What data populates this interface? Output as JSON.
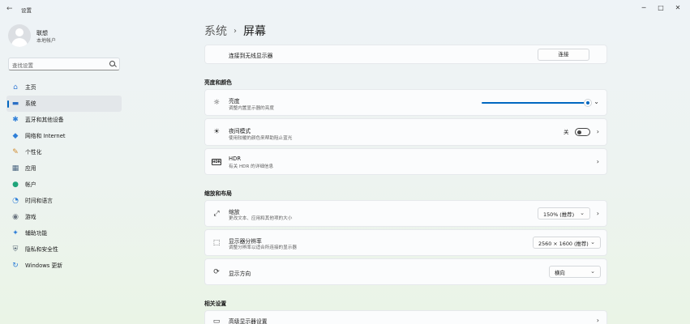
{
  "window": {
    "title": "设置",
    "back_glyph": "←",
    "minimize_glyph": "─",
    "maximize_glyph": "□",
    "close_glyph": "✕"
  },
  "profile": {
    "name": "联想",
    "account": "本地帐户"
  },
  "search": {
    "placeholder": "查找设置"
  },
  "nav": {
    "items": [
      {
        "label": "主页",
        "icon": "home-icon",
        "glyph": "⌂",
        "color": "#3b7ed6"
      },
      {
        "label": "系统",
        "icon": "monitor-icon",
        "glyph": "▬",
        "color": "#2b6fc5",
        "active": true
      },
      {
        "label": "蓝牙和其他设备",
        "icon": "bluetooth-icon",
        "glyph": "✱",
        "color": "#2f7fd8"
      },
      {
        "label": "网络和 Internet",
        "icon": "wifi-icon",
        "glyph": "◆",
        "color": "#2f7fd8"
      },
      {
        "label": "个性化",
        "icon": "brush-icon",
        "glyph": "✎",
        "color": "#d08a2e"
      },
      {
        "label": "应用",
        "icon": "apps-icon",
        "glyph": "▦",
        "color": "#4c6680"
      },
      {
        "label": "帐户",
        "icon": "person-icon",
        "glyph": "●",
        "color": "#1fa47a"
      },
      {
        "label": "时间和语言",
        "icon": "globe-clock-icon",
        "glyph": "◔",
        "color": "#2f7fd8"
      },
      {
        "label": "游戏",
        "icon": "gamepad-icon",
        "glyph": "◉",
        "color": "#6b7580"
      },
      {
        "label": "辅助功能",
        "icon": "accessibility-icon",
        "glyph": "✦",
        "color": "#2f7fd8"
      },
      {
        "label": "隐私和安全性",
        "icon": "shield-icon",
        "glyph": "⛨",
        "color": "#5a6a78"
      },
      {
        "label": "Windows 更新",
        "icon": "update-icon",
        "glyph": "↻",
        "color": "#2f7fd8"
      }
    ]
  },
  "breadcrumb": {
    "parent": "系统",
    "separator": "›",
    "current": "屏幕"
  },
  "wireless": {
    "label": "连接到无线显示器",
    "button": "连接"
  },
  "sections": {
    "brightness": "亮度和颜色",
    "scale_layout": "缩放和布局",
    "related": "相关设置"
  },
  "brightness": {
    "title": "亮度",
    "subtitle": "调整内置显示器的亮度",
    "icon_glyph": "☼",
    "level_percent": 100,
    "chevron": "⌄"
  },
  "night_light": {
    "title": "夜间模式",
    "subtitle": "使用较暖的颜色来帮助阻止蓝光",
    "icon_glyph": "☀",
    "state_label": "关",
    "chevron": "›"
  },
  "hdr": {
    "title": "HDR",
    "subtitle": "有关 HDR 的详细信息",
    "icon_text": "HDR",
    "chevron": "›"
  },
  "scale": {
    "title": "缩放",
    "subtitle": "更改文本、应用和其他项的大小",
    "icon_glyph": "⤢",
    "value": "150% (推荐)",
    "dropdown_glyph": "⌄",
    "chevron": "›"
  },
  "resolution": {
    "title": "显示器分辨率",
    "subtitle": "调整分辨率以适合所连接的显示器",
    "icon_glyph": "⬚",
    "value": "2560 × 1600 (推荐)",
    "dropdown_glyph": "⌄"
  },
  "orientation": {
    "title": "显示方向",
    "icon_glyph": "⟳",
    "value": "横向",
    "dropdown_glyph": "⌄"
  },
  "advanced": {
    "title": "高级显示器设置",
    "icon_glyph": "▭",
    "chevron": "›"
  },
  "colors": {
    "accent": "#0067c0"
  }
}
